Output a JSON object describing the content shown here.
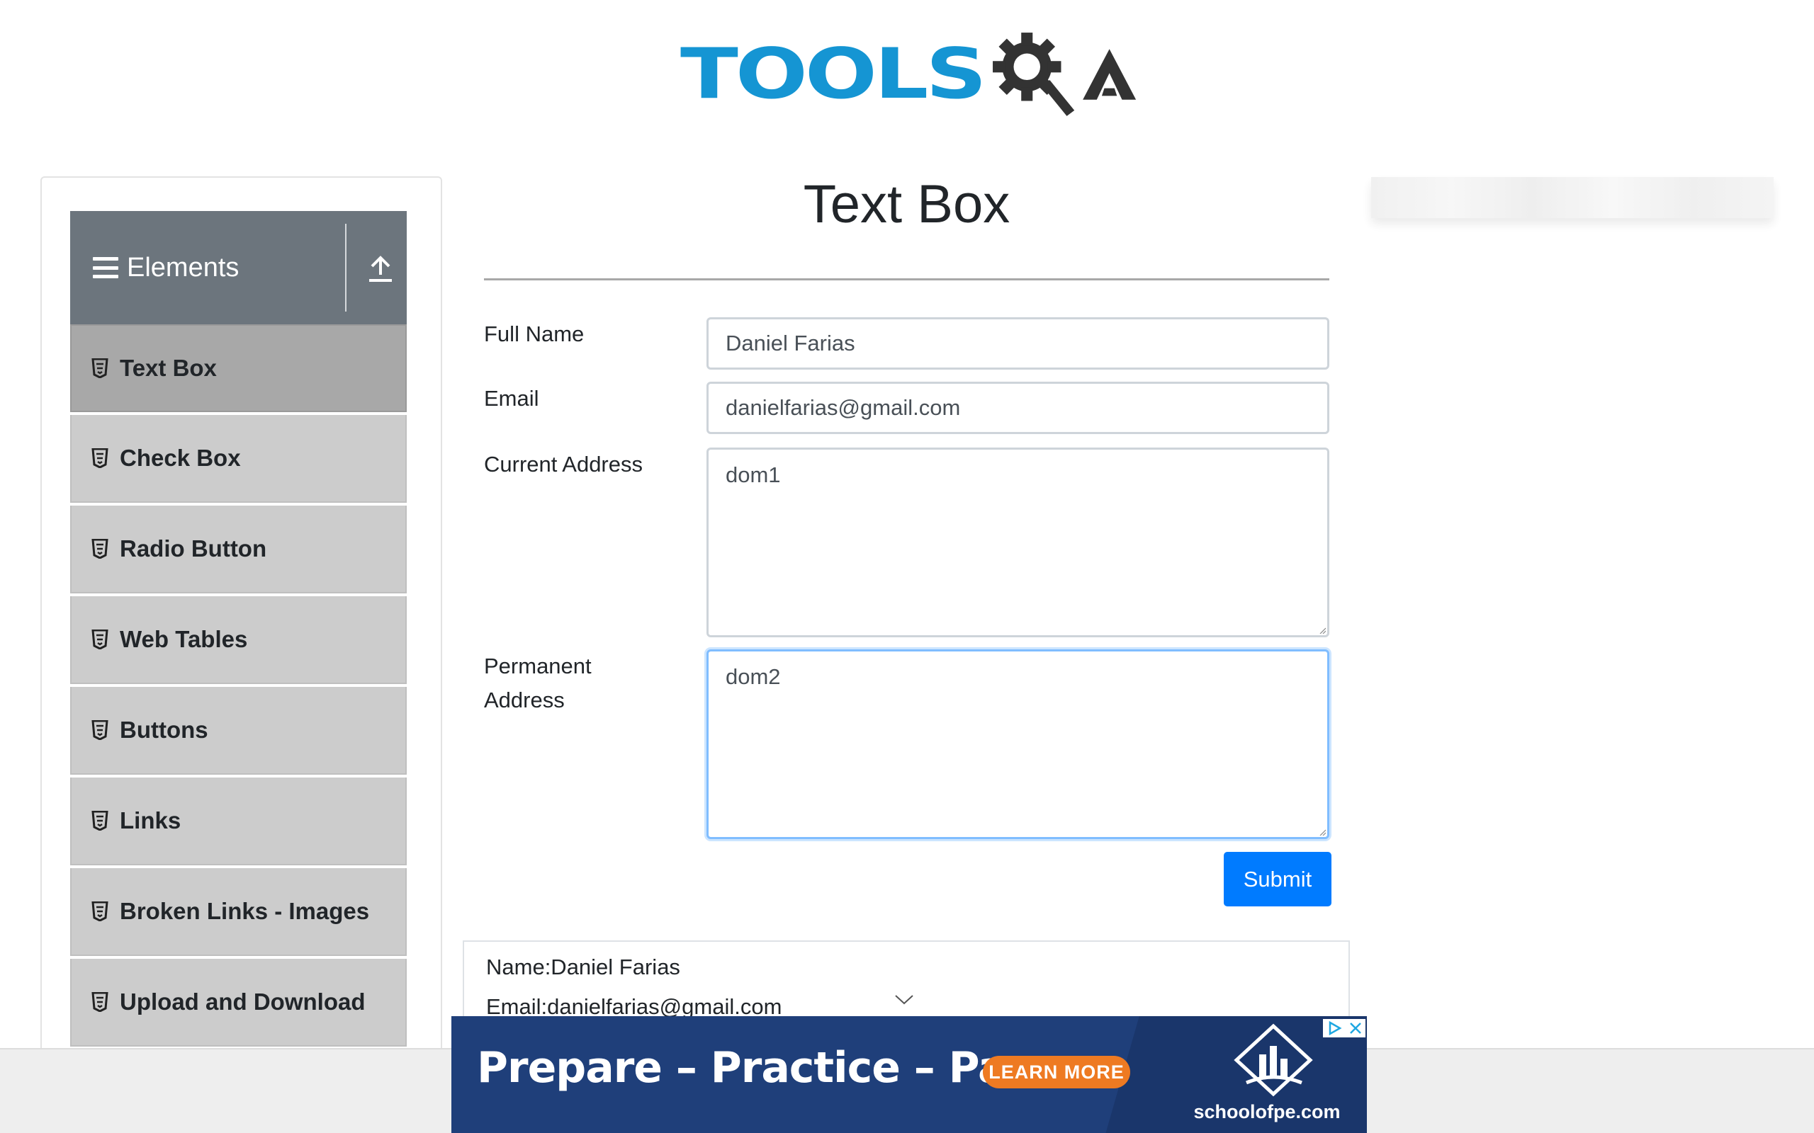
{
  "header": {
    "logo_text": "TOOLS",
    "logo_suffix": "QA"
  },
  "sidebar": {
    "group_title": "Elements",
    "items": [
      {
        "label": "Text Box",
        "active": true
      },
      {
        "label": "Check Box"
      },
      {
        "label": "Radio Button"
      },
      {
        "label": "Web Tables"
      },
      {
        "label": "Buttons"
      },
      {
        "label": "Links"
      },
      {
        "label": "Broken Links - Images"
      },
      {
        "label": "Upload and Download"
      }
    ]
  },
  "main": {
    "title": "Text Box",
    "form": {
      "full_name_label": "Full Name",
      "full_name_value": "Daniel Farias",
      "email_label": "Email",
      "email_value": "danielfarias@gmail.com",
      "current_address_label": "Current Address",
      "current_address_value": "dom1",
      "permanent_address_label_1": "Permanent",
      "permanent_address_label_2": "Address",
      "permanent_address_value": "dom2",
      "submit_label": "Submit"
    },
    "output": {
      "name_line": "Name:Daniel Farias",
      "email_line": "Email:danielfarias@gmail.com"
    }
  },
  "banner_ad": {
    "headline": "Prepare – Practice – Pass",
    "cta": "LEARN MORE",
    "brand": "schoolofpe.com"
  },
  "colors": {
    "logo_blue": "#1595d3",
    "sidebar_header": "#6c757d",
    "menu_item": "#cccccc",
    "menu_item_active": "#a8a8a8",
    "submit": "#007bff",
    "banner": "#1f3f7a",
    "cta": "#ee7a22"
  }
}
